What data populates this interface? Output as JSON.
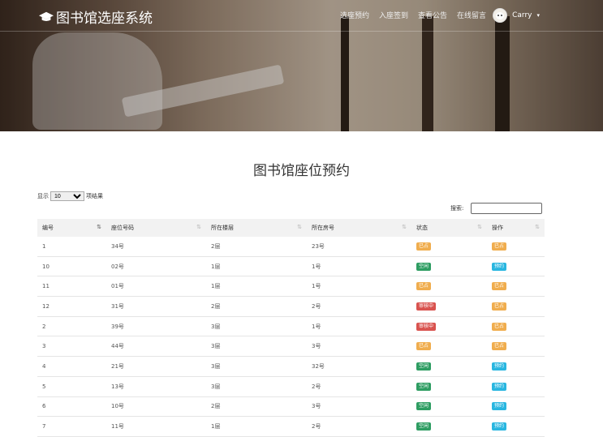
{
  "header": {
    "brand": "图书馆选座系统",
    "nav": [
      "选座预约",
      "入座签到",
      "查看公告",
      "在线留言"
    ],
    "user_name": "Carry",
    "caret": "▾"
  },
  "page_title": "图书馆座位预约",
  "length": {
    "prefix": "显示",
    "selected": "10",
    "suffix": "项结果"
  },
  "search": {
    "label": "搜索:",
    "value": ""
  },
  "columns": [
    "编号",
    "座位号码",
    "所在楼层",
    "所在房号",
    "状态",
    "操作"
  ],
  "rows": [
    {
      "id": "1",
      "seat": "34号",
      "floor": "2层",
      "room": "23号",
      "status": "已占",
      "status_color": "#f0ad4e",
      "action": "已占",
      "action_color": "#f0ad4e"
    },
    {
      "id": "10",
      "seat": "02号",
      "floor": "1层",
      "room": "1号",
      "status": "空闲",
      "status_color": "#2e9d62",
      "action": "预约",
      "action_color": "#29b6e0"
    },
    {
      "id": "11",
      "seat": "01号",
      "floor": "1层",
      "room": "1号",
      "status": "已占",
      "status_color": "#f0ad4e",
      "action": "已占",
      "action_color": "#f0ad4e"
    },
    {
      "id": "12",
      "seat": "31号",
      "floor": "2层",
      "room": "2号",
      "status": "审核中",
      "status_color": "#d9534f",
      "action": "已占",
      "action_color": "#f0ad4e"
    },
    {
      "id": "2",
      "seat": "39号",
      "floor": "3层",
      "room": "1号",
      "status": "审核中",
      "status_color": "#d9534f",
      "action": "已占",
      "action_color": "#f0ad4e"
    },
    {
      "id": "3",
      "seat": "44号",
      "floor": "3层",
      "room": "3号",
      "status": "已占",
      "status_color": "#f0ad4e",
      "action": "已占",
      "action_color": "#f0ad4e"
    },
    {
      "id": "4",
      "seat": "21号",
      "floor": "3层",
      "room": "32号",
      "status": "空闲",
      "status_color": "#2e9d62",
      "action": "预约",
      "action_color": "#29b6e0"
    },
    {
      "id": "5",
      "seat": "13号",
      "floor": "3层",
      "room": "2号",
      "status": "空闲",
      "status_color": "#2e9d62",
      "action": "预约",
      "action_color": "#29b6e0"
    },
    {
      "id": "6",
      "seat": "10号",
      "floor": "2层",
      "room": "3号",
      "status": "空闲",
      "status_color": "#2e9d62",
      "action": "预约",
      "action_color": "#29b6e0"
    },
    {
      "id": "7",
      "seat": "11号",
      "floor": "1层",
      "room": "2号",
      "status": "空闲",
      "status_color": "#2e9d62",
      "action": "预约",
      "action_color": "#29b6e0"
    }
  ]
}
